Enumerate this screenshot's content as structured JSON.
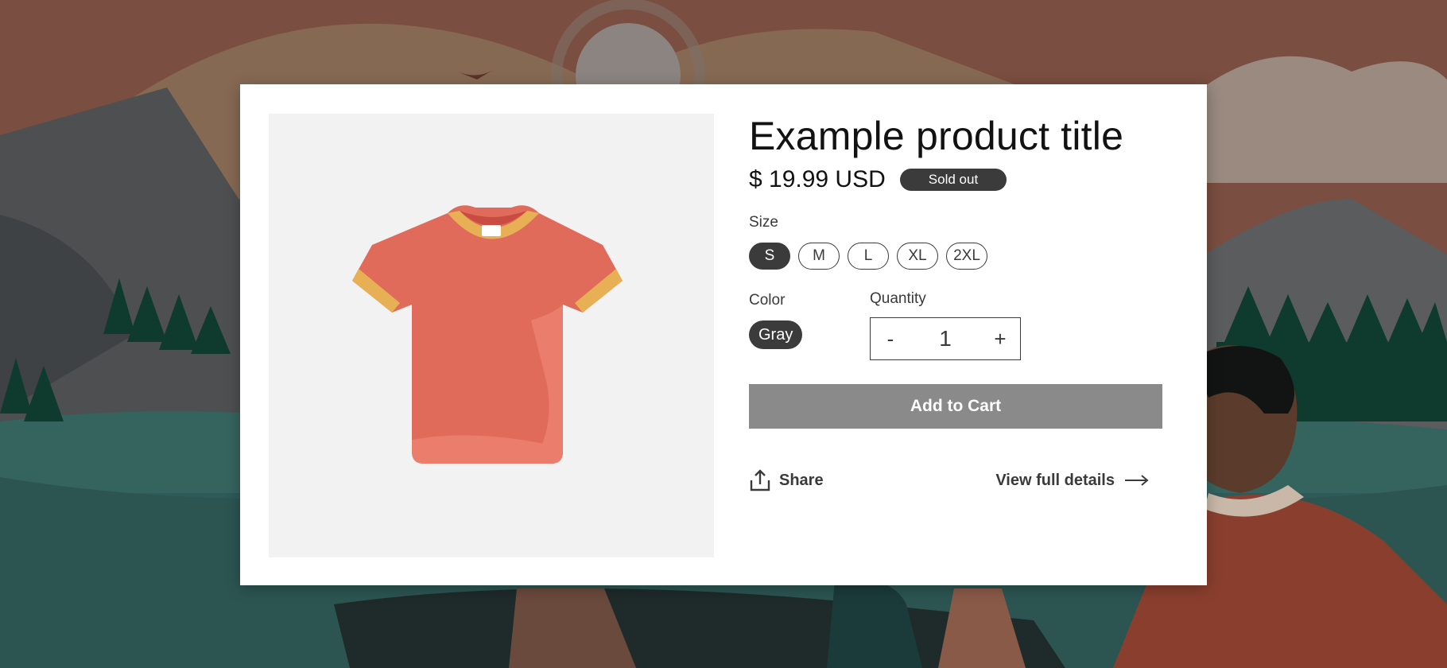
{
  "product": {
    "title": "Example product title",
    "price": "$ 19.99 USD",
    "badge": "Sold out",
    "image_icon": "t-shirt-illustration"
  },
  "size": {
    "label": "Size",
    "options": [
      "S",
      "M",
      "L",
      "XL",
      "2XL"
    ],
    "selected": "S"
  },
  "color": {
    "label": "Color",
    "selected": "Gray"
  },
  "quantity": {
    "label": "Quantity",
    "value": "1",
    "decrement": "-",
    "increment": "+"
  },
  "actions": {
    "add_to_cart": "Add to Cart",
    "share": "Share",
    "share_icon": "share-icon",
    "view_details": "View full details",
    "arrow_icon": "arrow-right-icon"
  },
  "colors": {
    "badge_bg": "#3b3b3b",
    "cart_bg": "#8a8a8a",
    "shirt": "#e06b5a",
    "trim": "#e8b055"
  }
}
